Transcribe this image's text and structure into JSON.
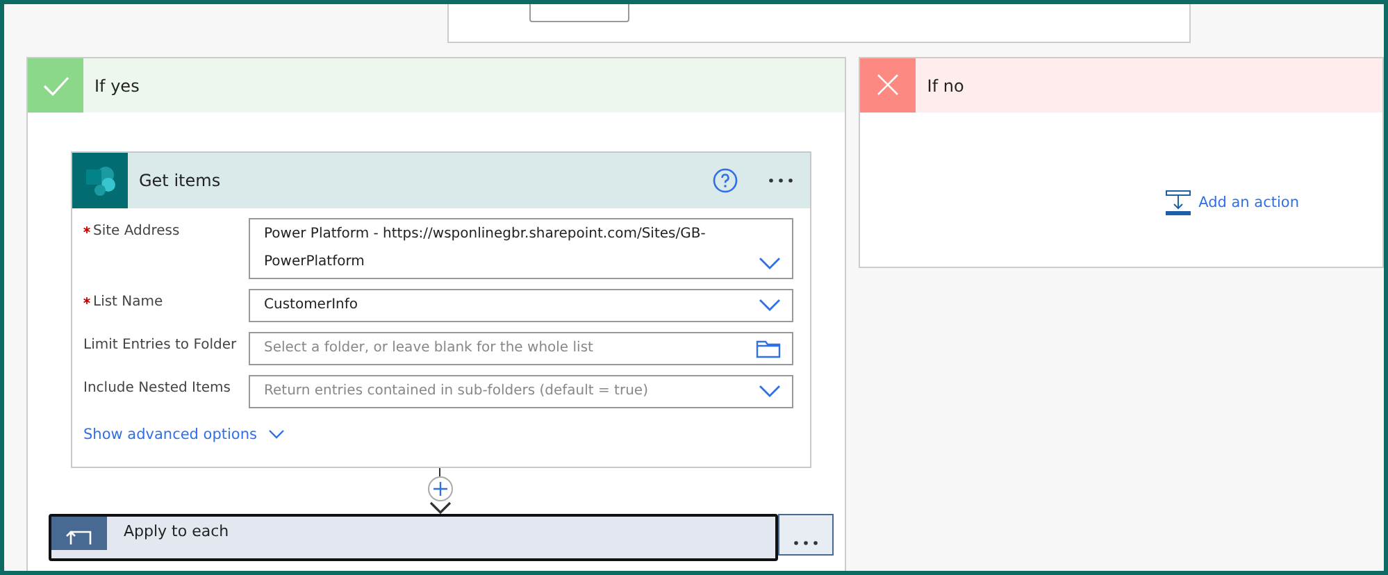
{
  "yes_branch": {
    "title": "If yes",
    "action": {
      "title": "Get items",
      "fields": [
        {
          "label": "Site Address",
          "required": true,
          "value": "Power Platform - https://wsponlinegbr.sharepoint.com/Sites/GB-PowerPlatform",
          "kind": "dropdown"
        },
        {
          "label": "List Name",
          "required": true,
          "value": "CustomerInfo",
          "kind": "dropdown"
        },
        {
          "label": "Limit Entries to Folder",
          "required": false,
          "placeholder": "Select a folder, or leave blank for the whole list",
          "kind": "folder"
        },
        {
          "label": "Include Nested Items",
          "required": false,
          "placeholder": "Return entries contained in sub-folders (default = true)",
          "kind": "dropdown"
        }
      ],
      "advanced_link": "Show advanced options"
    },
    "next_action": {
      "title": "Apply to each"
    }
  },
  "no_branch": {
    "title": "If no",
    "add_action": "Add an action"
  }
}
